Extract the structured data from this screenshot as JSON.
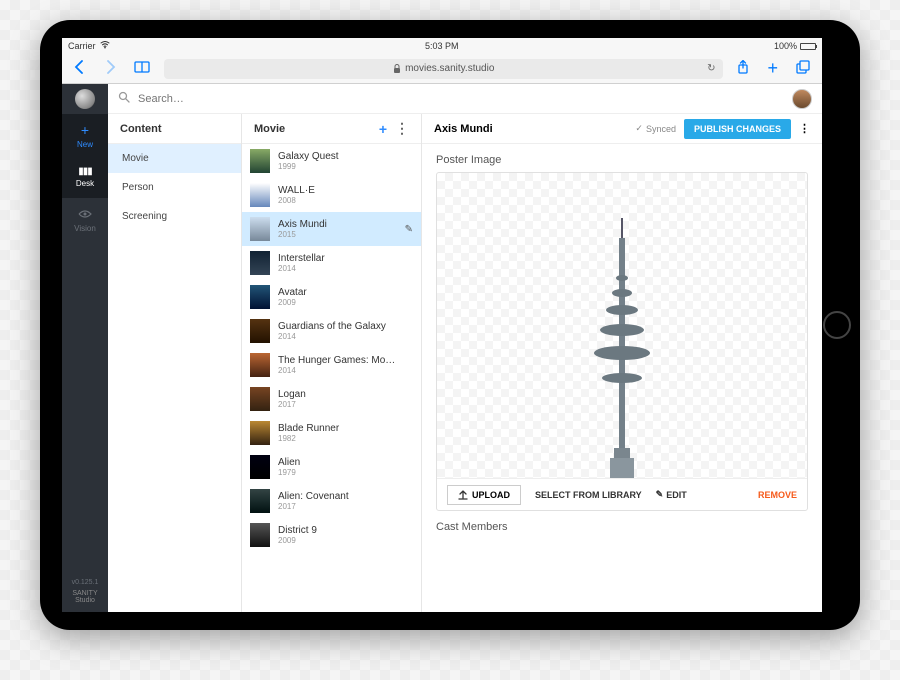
{
  "status": {
    "carrier": "Carrier",
    "time": "5:03 PM",
    "battery": "100%"
  },
  "browser": {
    "url": "movies.sanity.studio"
  },
  "rail": {
    "items": [
      {
        "icon": "+",
        "label": "New"
      },
      {
        "icon": "▮▮▮",
        "label": "Desk"
      },
      {
        "icon": "◉",
        "label": "Vision"
      }
    ],
    "version": "v0.125.1",
    "brand": "SANITY Studio"
  },
  "search": {
    "placeholder": "Search…"
  },
  "content": {
    "title": "Content",
    "items": [
      "Movie",
      "Person",
      "Screening"
    ],
    "selected": "Movie"
  },
  "movies": {
    "title": "Movie",
    "items": [
      {
        "title": "Galaxy Quest",
        "year": "1999"
      },
      {
        "title": "WALL·E",
        "year": "2008"
      },
      {
        "title": "Axis Mundi",
        "year": "2015",
        "selected": true
      },
      {
        "title": "Interstellar",
        "year": "2014"
      },
      {
        "title": "Avatar",
        "year": "2009"
      },
      {
        "title": "Guardians of the Galaxy",
        "year": "2014"
      },
      {
        "title": "The Hunger Games: Mockin…",
        "year": "2014"
      },
      {
        "title": "Logan",
        "year": "2017"
      },
      {
        "title": "Blade Runner",
        "year": "1982"
      },
      {
        "title": "Alien",
        "year": "1979"
      },
      {
        "title": "Alien: Covenant",
        "year": "2017"
      },
      {
        "title": "District 9",
        "year": "2009"
      }
    ]
  },
  "detail": {
    "title": "Axis Mundi",
    "sync": "Synced",
    "publish": "PUBLISH CHANGES",
    "poster_label": "Poster Image",
    "upload": "UPLOAD",
    "select_lib": "SELECT FROM LIBRARY",
    "edit": "EDIT",
    "remove": "REMOVE",
    "cast_label": "Cast Members"
  }
}
